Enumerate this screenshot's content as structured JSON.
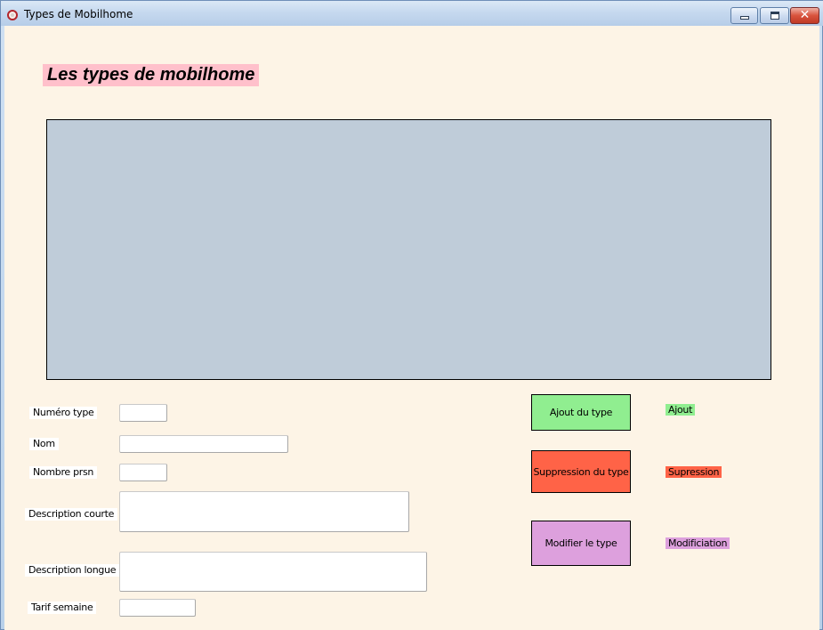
{
  "window": {
    "title": "Types de Mobilhome",
    "icon": "app-round-icon",
    "controls": {
      "minimize": "minimize-icon",
      "maximize": "maximize-icon",
      "close": "✕"
    }
  },
  "heading": "Les types de mobilhome",
  "grid": {
    "rows": []
  },
  "form": {
    "numero_type": {
      "label": "Numéro type",
      "value": ""
    },
    "nom": {
      "label": "Nom",
      "value": ""
    },
    "nombre_prsn": {
      "label": "Nombre prsn",
      "value": ""
    },
    "description_courte": {
      "label": "Description courte",
      "value": ""
    },
    "description_longue": {
      "label": "Description longue",
      "value": ""
    },
    "tarif_semaine": {
      "label": "Tarif semaine",
      "value": ""
    }
  },
  "actions": {
    "add": {
      "label": "Ajout du type",
      "color": "#90ee90"
    },
    "delete": {
      "label": "Suppression du type",
      "color": "#ff6347"
    },
    "modify": {
      "label": "Modifier le type",
      "color": "#dda0dd"
    }
  },
  "status_tags": {
    "add": "Ajout",
    "delete": "Supression",
    "modify": "Modificiation"
  },
  "colors": {
    "background": "#fdf4e6",
    "heading_bg": "#ffc0cb",
    "grid_bg": "#bfccd9"
  }
}
